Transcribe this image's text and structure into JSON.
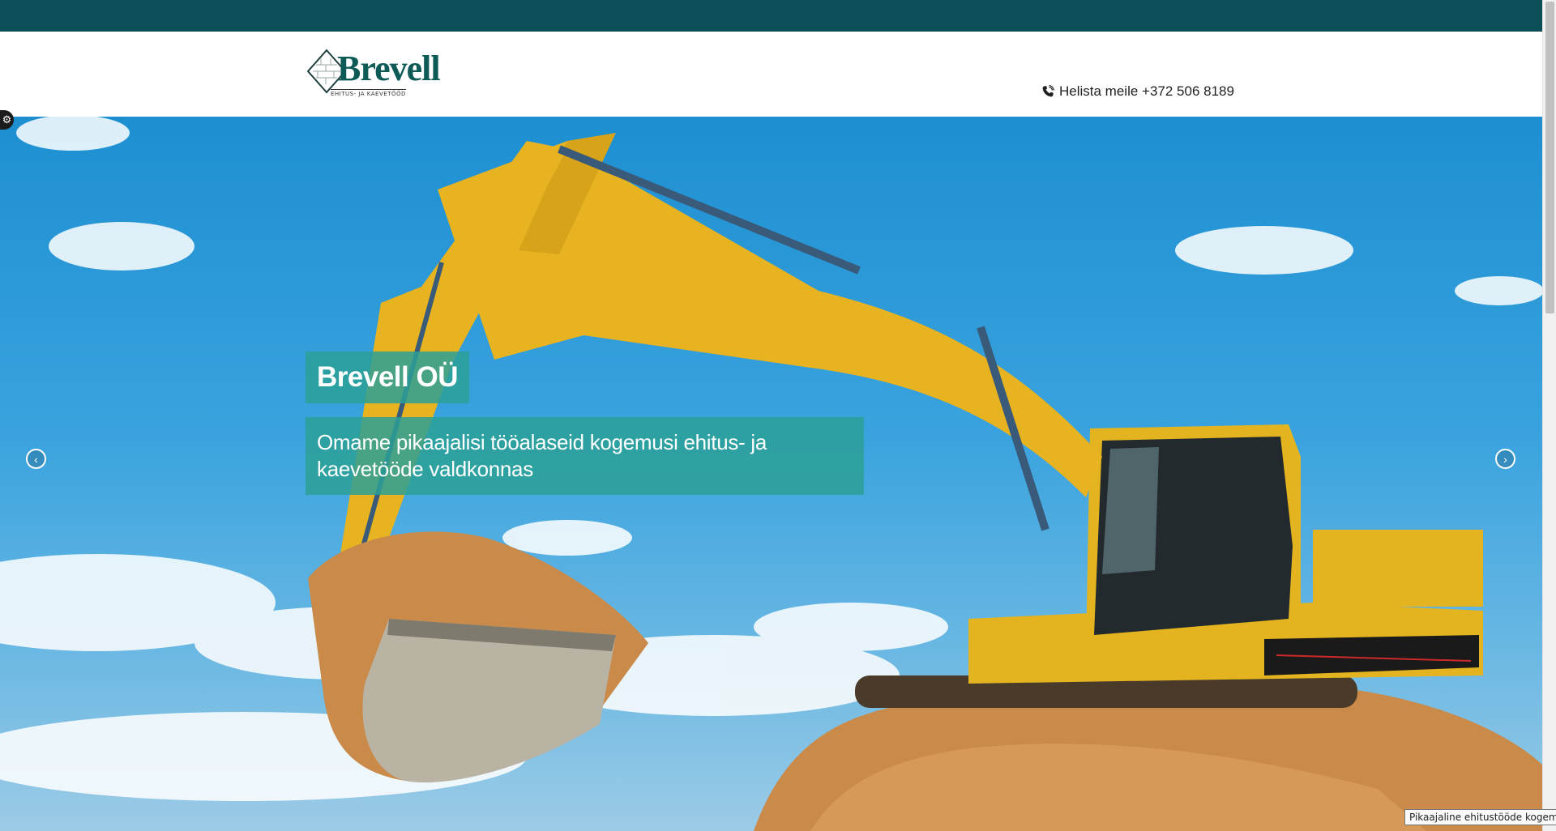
{
  "colors": {
    "topbar": "#0b4f58",
    "brand": "#0e5a57",
    "caption_bg": "#2ba096",
    "sky": "#2f9cdb"
  },
  "header": {
    "logo": {
      "name": "Brevell",
      "tagline": "EHITUS- JA KAEVETÖÖD"
    },
    "phone": {
      "icon": "phone-icon",
      "text": "Helista meile +372 506 8189"
    }
  },
  "hero": {
    "title": "Brevell OÜ",
    "text": "Omame pikaajalisi tööalaseid kogemusi ehitus- ja kaevetööde valdkonnas",
    "prev_icon": "chevron-left-icon",
    "next_icon": "chevron-right-icon"
  },
  "settings": {
    "icon": "gear-icon"
  },
  "tooltip": "Pikaajaline ehitustööde kogemus"
}
